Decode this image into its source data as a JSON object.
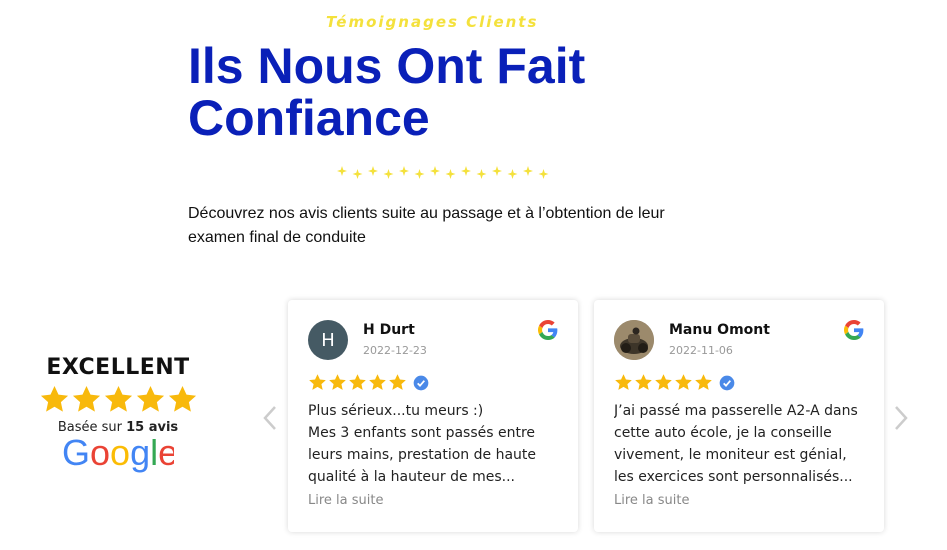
{
  "header": {
    "eyebrow": "Témoignages Clients",
    "title": "Ils Nous Ont Fait Confiance",
    "intro": "Découvrez nos avis clients suite au passage et à l’obtention de leur examen final de conduite"
  },
  "badge": {
    "rating_label": "EXCELLENT",
    "stars": 5,
    "based_prefix": "Basée sur",
    "based_count": "15 avis",
    "provider": "Google"
  },
  "carousel": {
    "prev_icon": "chevron-left-icon",
    "next_icon": "chevron-right-icon",
    "reviews": [
      {
        "avatar_initial": "H",
        "name": "H Durt",
        "date": "2022-12-23",
        "stars": 5,
        "text": "Plus sérieux...tu meurs :)\nMes 3 enfants sont passés entre leurs mains, prestation de haute qualité à la hauteur de mes...",
        "read_more": "Lire la suite"
      },
      {
        "avatar_initial": "",
        "name": "Manu Omont",
        "date": "2022-11-06",
        "stars": 5,
        "text": "J’ai passé ma passerelle A2-A dans cette auto école, je la conseille vivement, le moniteur est génial, les exercices sont personnalisés...",
        "read_more": "Lire la suite"
      }
    ]
  },
  "colors": {
    "title": "#0a20b8",
    "eyebrow": "#f4e13c",
    "star": "#f8b90c",
    "verified": "#4a89e8"
  }
}
